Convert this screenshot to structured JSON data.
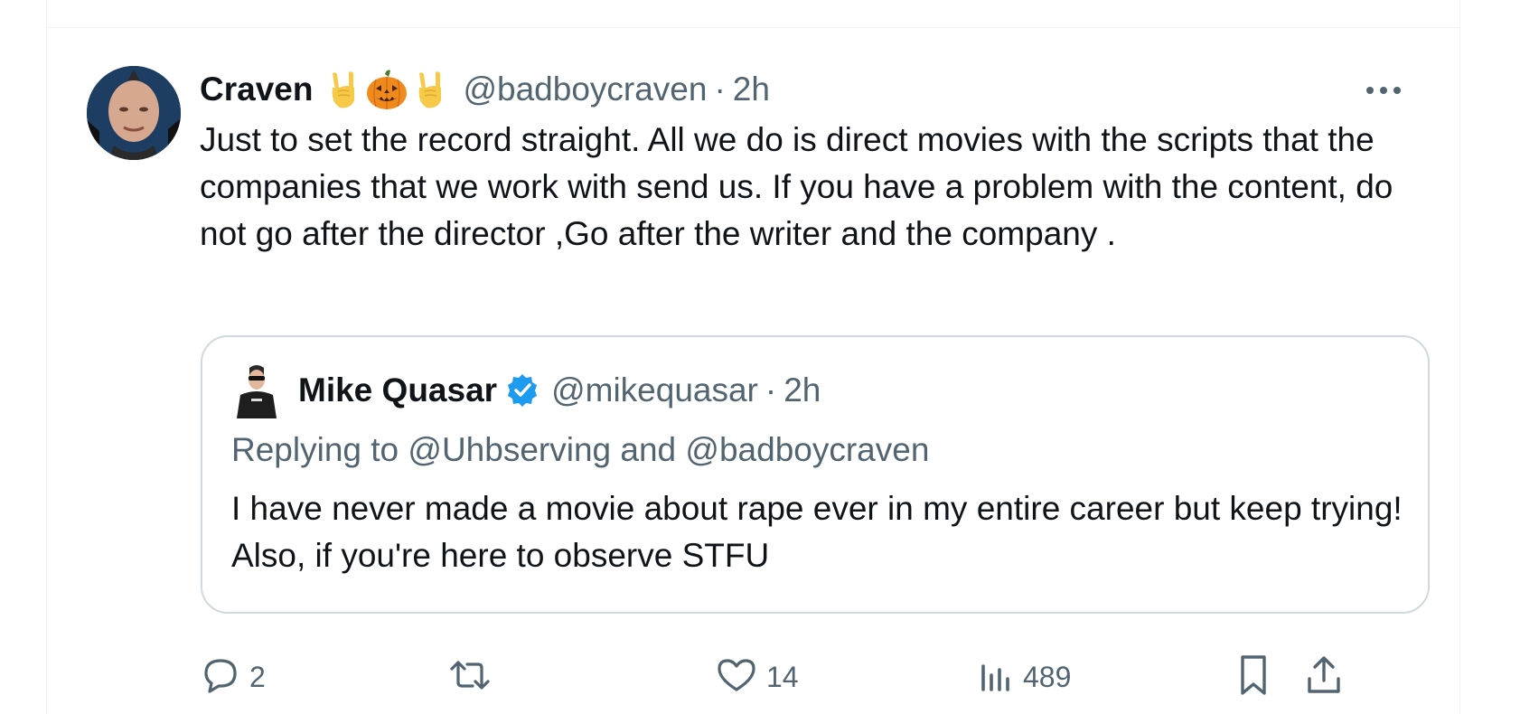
{
  "author": {
    "display_name": "Craven",
    "name_emojis": [
      "sign-of-horns-icon",
      "jack-o-lantern-icon",
      "sign-of-horns-icon"
    ],
    "handle": "@badboycraven",
    "separator": "·",
    "time": "2h"
  },
  "tweet": {
    "text": "Just to set the record straight. All we do is direct movies with the scripts that the companies that we work with send us. If you have a problem with the content, do not go after the director ,Go after the writer and the company ."
  },
  "quoted_tweet": {
    "display_name": "Mike Quasar",
    "verified": true,
    "handle": "@mikequasar",
    "separator": "·",
    "time": "2h",
    "replying_prefix": "Replying to ",
    "replying_mention_1": "@Uhbserving",
    "replying_joiner": " and ",
    "replying_mention_2": "@badboycraven",
    "text": "I have never made a movie about rape ever in my entire career but keep trying! Also, if you're here to observe STFU"
  },
  "actions": {
    "reply_count": "2",
    "retweet_count": "",
    "like_count": "14",
    "views_count": "489"
  },
  "colors": {
    "text_primary": "#0f1419",
    "text_secondary": "#536471",
    "border": "#cfd9de",
    "verified_blue": "#1d9bf0"
  }
}
